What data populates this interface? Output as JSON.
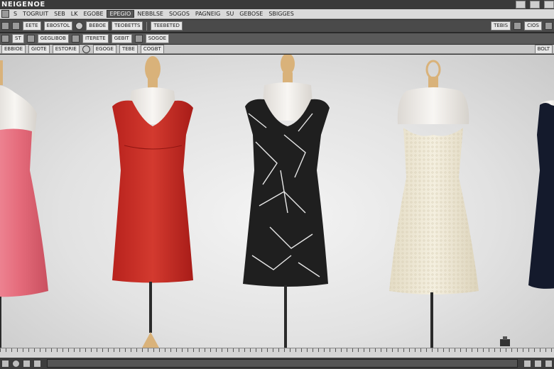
{
  "window": {
    "title": "NEIGENOE"
  },
  "menubar": {
    "items": [
      "S",
      "TOGRUIT",
      "SEB",
      "LK",
      "EGOBE",
      "EPEGIO",
      "NEBBLSE",
      "SOGOS",
      "PAGNEIG",
      "SU",
      "GEBOSE",
      "SBIGGES"
    ]
  },
  "toolbar1": {
    "fields": [
      "EETE",
      "EBOSTOL",
      "BEBOE",
      "TEOBETTS",
      "TEEBETED",
      "TEBIS",
      "CIOS"
    ]
  },
  "toolbar2": {
    "fields": [
      "ST",
      "GEGLIBOB",
      "ITERETE",
      "GEBIT",
      "SOGOE"
    ]
  },
  "toolbar3": {
    "fields": [
      "EBBIOE",
      "GIOTE",
      "ESTORIE",
      "EGOGE",
      "TEBE",
      "COGBT",
      "BOLT"
    ]
  },
  "colors": {
    "dress_pink": "#e46a7a",
    "dress_red": "#c42a24",
    "dress_black": "#1f1f1f",
    "dress_cream": "#efe9d6",
    "dress_navy": "#141a2c",
    "mannequin_skin": "#f3f0ec",
    "wood": "#d9b27a"
  },
  "mannequins": [
    {
      "name": "pink-dress-mannequin",
      "dress": "pink"
    },
    {
      "name": "red-dress-mannequin",
      "dress": "red"
    },
    {
      "name": "black-print-dress-mannequin",
      "dress": "black"
    },
    {
      "name": "cream-lace-dress-mannequin",
      "dress": "cream"
    },
    {
      "name": "navy-dress-mannequin",
      "dress": "navy"
    }
  ],
  "icons": {
    "minimize": "minimize-icon",
    "maximize": "maximize-icon",
    "close": "close-icon",
    "record": "record-icon",
    "settings": "gear-icon"
  }
}
